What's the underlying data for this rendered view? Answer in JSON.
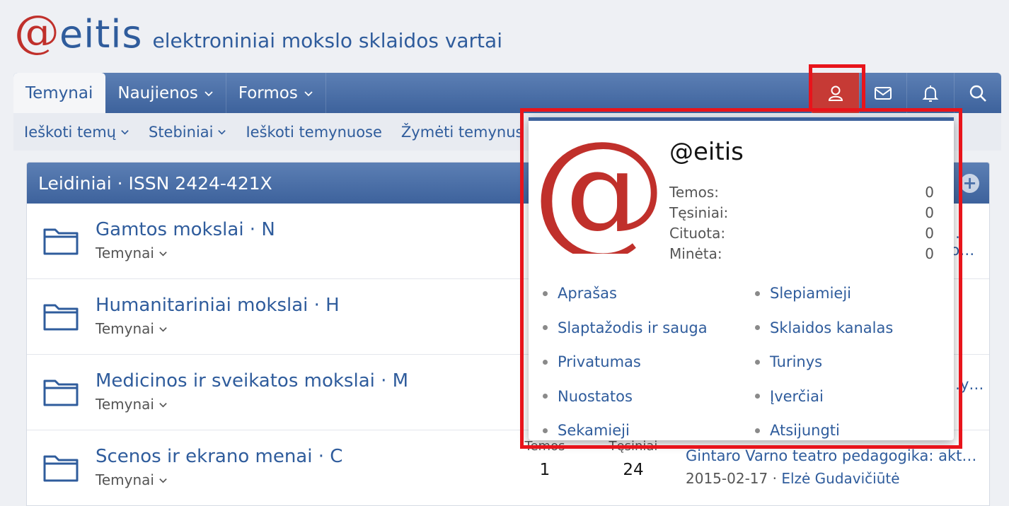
{
  "site": {
    "logo_at": "@",
    "logo_name": "eitis",
    "tagline": "elektroniniai mokslo sklaidos vartai"
  },
  "nav": {
    "tabs": [
      {
        "label": "Temynai",
        "active": true
      },
      {
        "label": "Naujienos",
        "dropdown": true
      },
      {
        "label": "Formos",
        "dropdown": true
      }
    ],
    "icons": [
      "user-icon",
      "mail-icon",
      "bell-icon",
      "search-icon"
    ]
  },
  "subnav": {
    "items": [
      {
        "label": "Ieškoti temų",
        "dropdown": true
      },
      {
        "label": "Stebiniai",
        "dropdown": true
      },
      {
        "label": "Ieškoti temynuose"
      },
      {
        "label": "Žymėti temynus skaitytais"
      }
    ]
  },
  "block": {
    "title": "Leidiniai · ISSN 2424-421X",
    "rows": [
      {
        "title": "Gamtos mokslai · N",
        "sub": "Temynai",
        "peek": "…fo…"
      },
      {
        "title": "Humanitariniai mokslai · H",
        "sub": "Temynai"
      },
      {
        "title": "Medicinos ir sveikatos mokslai · M",
        "sub": "Temynai",
        "peek": "…y…"
      },
      {
        "title": "Scenos ir ekrano menai · C",
        "sub": "Temynai",
        "stat1_label": "Temos",
        "stat1_value": "1",
        "stat2_label": "Tęsiniai",
        "stat2_value": "24",
        "latest_title": "Gintaro Varno teatro pedagogika: aktoriaus rengimas",
        "latest_date": "2015-02-17",
        "latest_sep": " · ",
        "latest_user": "Elzė Gudavičiūtė"
      }
    ]
  },
  "popup": {
    "username": "@eitis",
    "stats": [
      {
        "label": "Temos:",
        "value": "0"
      },
      {
        "label": "Tęsiniai:",
        "value": "0"
      },
      {
        "label": "Cituota:",
        "value": "0"
      },
      {
        "label": "Minėta:",
        "value": "0"
      }
    ],
    "links": [
      "Aprašas",
      "Slepiamieji",
      "Slaptažodis ir sauga",
      "Sklaidos kanalas",
      "Privatumas",
      "Turinys",
      "Nuostatos",
      "Įverčiai",
      "Sekamieji",
      "Atsijungti"
    ]
  },
  "colors": {
    "brand_blue": "#2f5c9c",
    "brand_red": "#c0302b",
    "annotation_red": "#e8141b"
  }
}
